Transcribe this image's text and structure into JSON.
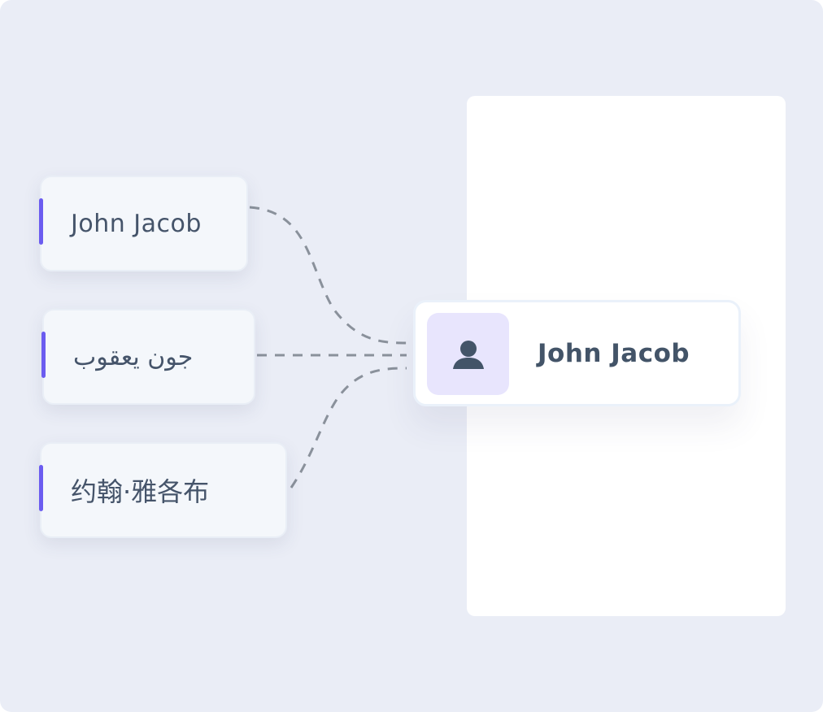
{
  "diagram": {
    "source_names": [
      {
        "label": "John Jacob",
        "script": "Latin"
      },
      {
        "label": "جون يعقوب",
        "script": "Arabic"
      },
      {
        "label": "约翰·雅各布",
        "script": "Chinese"
      }
    ],
    "target": {
      "label": "John Jacob",
      "icon": "user-icon"
    },
    "colors": {
      "background": "#eaedf6",
      "card": "#f4f7fb",
      "accent": "#6b5cf0",
      "text": "#45546a",
      "avatar_bg": "#e8e5fd",
      "avatar_icon": "#435468",
      "connector": "#8a919b"
    }
  }
}
